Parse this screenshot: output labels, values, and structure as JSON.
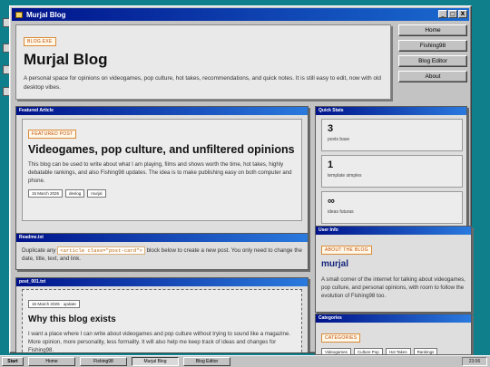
{
  "window": {
    "title": "Murjal Blog"
  },
  "title_controls": {
    "minimize": "_",
    "maximize": "□",
    "close": "X"
  },
  "header": {
    "tag": "BLOG.EXE",
    "title": "Murjal Blog",
    "description": "A personal space for opinions on videogames, pop culture, hot takes, recommendations, and quick notes. It is still easy to edit, now with old desktop vibes."
  },
  "nav": [
    "Home",
    "Fishing98",
    "Blog Editor",
    "About"
  ],
  "featured": {
    "window_title": "Featured Article",
    "tag": "FEATURED POST",
    "title": "Videogames, pop culture, and unfiltered opinions",
    "text": "This blog can be used to write about what I am playing, films and shows worth the time, hot takes, highly debatable rankings, and also Fishing98 updates. The idea is to make publishing easy on both computer and phone.",
    "chips": [
      "15 March 2026",
      "devlog",
      "murjal"
    ]
  },
  "stats": {
    "window_title": "Quick Stats",
    "cards": [
      {
        "value": "3",
        "label": "posts base"
      },
      {
        "value": "1",
        "label": "template simples"
      },
      {
        "value": "∞",
        "label": "ideas futuras"
      }
    ]
  },
  "readme": {
    "window_title": "Readme.txt",
    "text_before": "Duplicate any",
    "code": "<article class=\"post-card\">",
    "text_after": "block below to create a new post. You only need to change the date, title, text, and link."
  },
  "post": {
    "window_title": "post_001.txt",
    "meta": "15 March 2026 · update",
    "title": "Why this blog exists",
    "text": "I want a place where I can write about videogames and pop culture without trying to sound like a magazine. More opinion, more personality, less formality. It will also help me keep track of ideas and changes for Fishing98."
  },
  "userinfo": {
    "window_title": "User Info",
    "tag": "ABOUT THE BLOG",
    "name": "murjal",
    "text": "A small corner of the internet for talking about videogames, pop culture, and personal opinions, with room to follow the evolution of Fishing98 too."
  },
  "categories": {
    "window_title": "Categories",
    "tag": "CATEGORIES",
    "items": [
      "Videogames",
      "Culture Pop",
      "Hot Takes",
      "Rankings"
    ]
  },
  "taskbar": {
    "start": "Start",
    "buttons": [
      "Home",
      "Fishing98",
      "Murjal Blog",
      "Blog Editor"
    ],
    "active_index": 2,
    "clock": "23:06"
  }
}
